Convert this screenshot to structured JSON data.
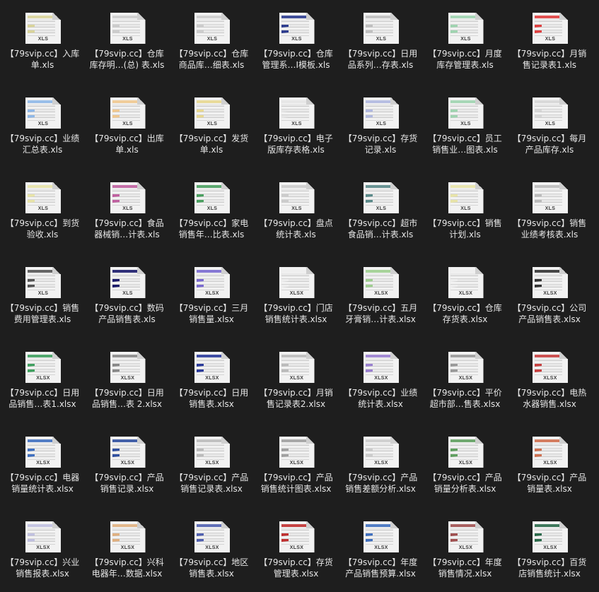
{
  "colors": {
    "background": "#1e1e1e",
    "label_text": "#e6e6e6",
    "page": "#f2f2f2"
  },
  "files": [
    {
      "l1": "【79svip.cc】入库",
      "l2": "单.xls",
      "type": "XLS",
      "accent": "#d9d49a"
    },
    {
      "l1": "【79svip.cc】仓库",
      "l2": "库存明…(总) 表.xls",
      "type": "XLS",
      "accent": "#cccccc"
    },
    {
      "l1": "【79svip.cc】仓库",
      "l2": "商品库…细表.xls",
      "type": "XLS",
      "accent": "#cccccc"
    },
    {
      "l1": "【79svip.cc】仓库",
      "l2": "管理系…I模板.xls",
      "type": "XLS",
      "accent": "#2e3d8f"
    },
    {
      "l1": "【79svip.cc】日用",
      "l2": "品系列…存表.xls",
      "type": "XLS",
      "accent": "#bfbfbf"
    },
    {
      "l1": "【79svip.cc】月度",
      "l2": "库存管理表.xls",
      "type": "XLS",
      "accent": "#9fd4b0"
    },
    {
      "l1": "【79svip.cc】月销",
      "l2": "售记录表1.xls",
      "type": "XLS",
      "accent": "#e04040"
    },
    {
      "l1": "【79svip.cc】业绩",
      "l2": "汇总表.xls",
      "type": "XLS",
      "accent": "#8fb8e8"
    },
    {
      "l1": "【79svip.cc】出库",
      "l2": "单.xls",
      "type": "XLS",
      "accent": "#f0c890"
    },
    {
      "l1": "【79svip.cc】发货",
      "l2": "单.xls",
      "type": "XLS",
      "accent": "#e8d890"
    },
    {
      "l1": "【79svip.cc】电子",
      "l2": "版库存表格.xls",
      "type": "XLS",
      "accent": "#e6e6e6"
    },
    {
      "l1": "【79svip.cc】存货",
      "l2": "记录.xls",
      "type": "XLS",
      "accent": "#b0b8e0"
    },
    {
      "l1": "【79svip.cc】员工",
      "l2": "销售业…图表.xls",
      "type": "XLS",
      "accent": "#9fd4b0"
    },
    {
      "l1": "【79svip.cc】每月",
      "l2": "产品库存.xls",
      "type": "XLS",
      "accent": "#d6d6d6"
    },
    {
      "l1": "【79svip.cc】到货",
      "l2": "验收.xls",
      "type": "XLS",
      "accent": "#e8e4a8"
    },
    {
      "l1": "【79svip.cc】食品",
      "l2": "器械销…计表.xls",
      "type": "XLS",
      "accent": "#c060a0"
    },
    {
      "l1": "【79svip.cc】家电",
      "l2": "销售年…比表.xls",
      "type": "XLS",
      "accent": "#4aa060"
    },
    {
      "l1": "【79svip.cc】盘点",
      "l2": "统计表.xls",
      "type": "XLS",
      "accent": "#cccccc"
    },
    {
      "l1": "【79svip.cc】超市",
      "l2": "食品销…计表.xls",
      "type": "XLS",
      "accent": "#5a8a8a"
    },
    {
      "l1": "【79svip.cc】销售",
      "l2": "计划.xls",
      "type": "XLS",
      "accent": "#e8e4a8"
    },
    {
      "l1": "【79svip.cc】销售",
      "l2": "业绩考核表.xls",
      "type": "XLS",
      "accent": "#bbbbbb"
    },
    {
      "l1": "【79svip.cc】销售",
      "l2": "费用管理表.xls",
      "type": "XLS",
      "accent": "#555555"
    },
    {
      "l1": "【79svip.cc】数码",
      "l2": "产品销售表.xls",
      "type": "XLS",
      "accent": "#1a1a6a"
    },
    {
      "l1": "【79svip.cc】三月",
      "l2": "销售量.xlsx",
      "type": "XLSX",
      "accent": "#7a6ad0"
    },
    {
      "l1": "【79svip.cc】门店",
      "l2": "销售统计表.xlsx",
      "type": "XLSX",
      "accent": "#eeeeee"
    },
    {
      "l1": "【79svip.cc】五月",
      "l2": "牙膏销…计表.xlsx",
      "type": "XLSX",
      "accent": "#9fcf90"
    },
    {
      "l1": "【79svip.cc】仓库",
      "l2": "存货表.xlsx",
      "type": "XLSX",
      "accent": "#eeeeee"
    },
    {
      "l1": "【79svip.cc】公司",
      "l2": "产品销售表.xlsx",
      "type": "XLSX",
      "accent": "#333333"
    },
    {
      "l1": "【79svip.cc】日用",
      "l2": "品销售…表1.xlsx",
      "type": "XLSX",
      "accent": "#40a060"
    },
    {
      "l1": "【79svip.cc】日用",
      "l2": "品销售…表 2.xlsx",
      "type": "XLSX",
      "accent": "#888888"
    },
    {
      "l1": "【79svip.cc】日用",
      "l2": "销售表.xlsx",
      "type": "XLSX",
      "accent": "#2a3a9a"
    },
    {
      "l1": "【79svip.cc】月销",
      "l2": "售记录表2.xlsx",
      "type": "XLSX",
      "accent": "#bbbbbb"
    },
    {
      "l1": "【79svip.cc】业绩",
      "l2": "统计表.xlsx",
      "type": "XLSX",
      "accent": "#9a80d0"
    },
    {
      "l1": "【79svip.cc】平价",
      "l2": "超市部…售表.xlsx",
      "type": "XLSX",
      "accent": "#999999"
    },
    {
      "l1": "【79svip.cc】电热",
      "l2": "水器销售.xlsx",
      "type": "XLSX",
      "accent": "#c84040"
    },
    {
      "l1": "【79svip.cc】电器",
      "l2": "销量统计表.xlsx",
      "type": "XLSX",
      "accent": "#4070c0"
    },
    {
      "l1": "【79svip.cc】产品",
      "l2": "销售记录.xlsx",
      "type": "XLSX",
      "accent": "#3050a0"
    },
    {
      "l1": "【79svip.cc】产品",
      "l2": "销售记录表.xlsx",
      "type": "XLSX",
      "accent": "#bbbbbb"
    },
    {
      "l1": "【79svip.cc】产品",
      "l2": "销售统计图表.xlsx",
      "type": "XLSX",
      "accent": "#a0a0a0"
    },
    {
      "l1": "【79svip.cc】产品",
      "l2": "销售差额分析.xlsx",
      "type": "XLSX",
      "accent": "#cccccc"
    },
    {
      "l1": "【79svip.cc】产品",
      "l2": "销量分析表.xlsx",
      "type": "XLSX",
      "accent": "#60a060"
    },
    {
      "l1": "【79svip.cc】产品",
      "l2": "销量表.xlsx",
      "type": "XLSX",
      "accent": "#d07050"
    },
    {
      "l1": "【79svip.cc】兴业",
      "l2": "销售报表.xlsx",
      "type": "XLSX",
      "accent": "#c0c0e0"
    },
    {
      "l1": "【79svip.cc】兴科",
      "l2": "电器年…数据.xlsx",
      "type": "XLSX",
      "accent": "#e0b080"
    },
    {
      "l1": "【79svip.cc】地区",
      "l2": "销售表.xlsx",
      "type": "XLSX",
      "accent": "#5060b0"
    },
    {
      "l1": "【79svip.cc】存货",
      "l2": "管理表.xlsx",
      "type": "XLSX",
      "accent": "#c03030"
    },
    {
      "l1": "【79svip.cc】年度",
      "l2": "产品销售预算.xlsx",
      "type": "XLSX",
      "accent": "#4070c0"
    },
    {
      "l1": "【79svip.cc】年度",
      "l2": "销售情况.xlsx",
      "type": "XLSX",
      "accent": "#a05050"
    },
    {
      "l1": "【79svip.cc】百货",
      "l2": "店销售统计.xlsx",
      "type": "XLSX",
      "accent": "#2a6a4a"
    }
  ]
}
